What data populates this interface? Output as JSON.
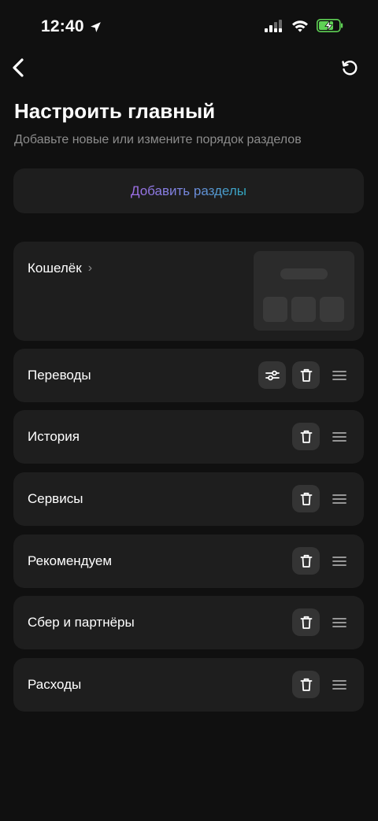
{
  "status_bar": {
    "time": "12:40"
  },
  "header": {
    "title": "Настроить главный",
    "subtitle": "Добавьте новые или измените порядок разделов"
  },
  "add_sections": {
    "label": "Добавить разделы",
    "gradient": [
      "#a06ee6",
      "#7b87e2",
      "#2fa9c0"
    ]
  },
  "wallet": {
    "label": "Кошелёк",
    "chevron": "›"
  },
  "sections": [
    {
      "label": "Переводы",
      "has_settings": true
    },
    {
      "label": "История",
      "has_settings": false
    },
    {
      "label": "Сервисы",
      "has_settings": false
    },
    {
      "label": "Рекомендуем",
      "has_settings": false
    },
    {
      "label": "Сбер и партнёры",
      "has_settings": false
    },
    {
      "label": "Расходы",
      "has_settings": false
    }
  ],
  "icons": {
    "back": "chevron-left-icon",
    "reset": "reset-icon",
    "settings": "sliders-icon",
    "delete": "trash-icon",
    "drag": "drag-handle-icon"
  },
  "colors": {
    "background": "#101010",
    "card": "#1e1e1e",
    "icon_button": "#343434",
    "secondary_text": "#8c8c8c",
    "battery": "#5fd155"
  }
}
